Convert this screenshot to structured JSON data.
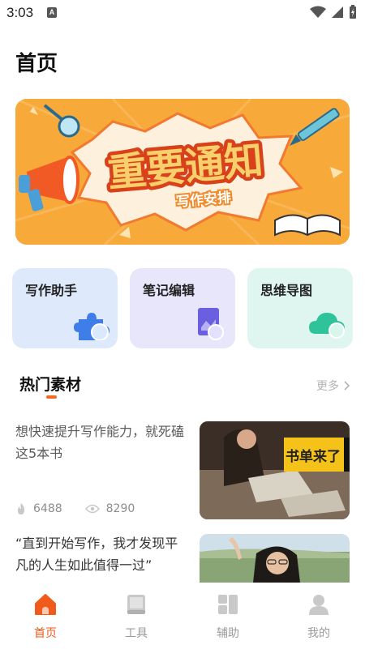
{
  "status_bar": {
    "time": "3:03",
    "notification_icon": "A"
  },
  "page": {
    "title": "首页"
  },
  "banner": {
    "headline": "重要通知",
    "subtitle": "写作安排"
  },
  "features": [
    {
      "label": "写作助手",
      "icon": "puzzle-icon"
    },
    {
      "label": "笔记编辑",
      "icon": "document-image-icon"
    },
    {
      "label": "思维导图",
      "icon": "cloud-icon"
    }
  ],
  "hot_section": {
    "title": "热门素材",
    "more_label": "更多"
  },
  "articles": [
    {
      "title": "想快速提升写作能力，就死磕这5本书",
      "likes": "6488",
      "views": "8290",
      "thumbnail_caption": "书单来了"
    },
    {
      "title": "“直到开始写作，我才发现平凡的人生如此值得一过”"
    }
  ],
  "nav": [
    {
      "label": "首页",
      "active": true
    },
    {
      "label": "工具",
      "active": false
    },
    {
      "label": "辅助",
      "active": false
    },
    {
      "label": "我的",
      "active": false
    }
  ],
  "colors": {
    "accent": "#f05a1a",
    "banner_orange": "#f7a93a",
    "card_writing": "#dfe9fc",
    "card_notes": "#e8e6fb",
    "card_mindmap": "#dff6f0"
  }
}
